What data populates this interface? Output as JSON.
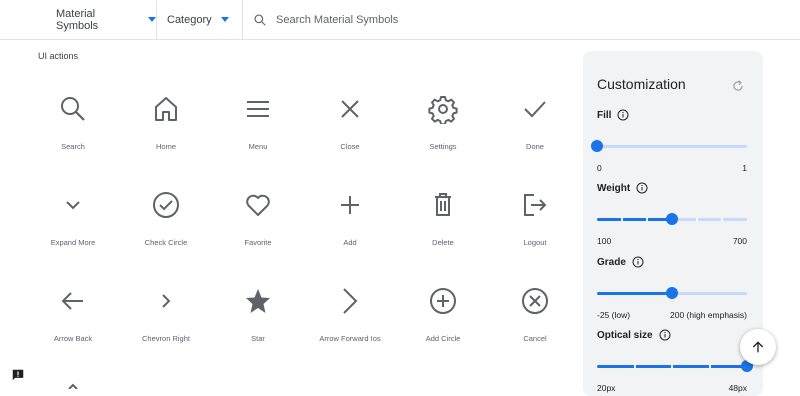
{
  "topbar": {
    "font_dropdown": "Material Symbols",
    "category_dropdown": "Category",
    "search_placeholder": "Search Material Symbols"
  },
  "section": {
    "title": "UI actions"
  },
  "icons": [
    {
      "label": "Search",
      "icon": "search-icon"
    },
    {
      "label": "Home",
      "icon": "home-icon"
    },
    {
      "label": "Menu",
      "icon": "menu-icon"
    },
    {
      "label": "Close",
      "icon": "close-icon"
    },
    {
      "label": "Settings",
      "icon": "settings-icon"
    },
    {
      "label": "Done",
      "icon": "done-icon"
    },
    {
      "label": "Expand More",
      "icon": "expand-more-icon"
    },
    {
      "label": "Check Circle",
      "icon": "check-circle-icon"
    },
    {
      "label": "Favorite",
      "icon": "favorite-icon"
    },
    {
      "label": "Add",
      "icon": "add-icon"
    },
    {
      "label": "Delete",
      "icon": "delete-icon"
    },
    {
      "label": "Logout",
      "icon": "logout-icon"
    },
    {
      "label": "Arrow Back",
      "icon": "arrow-back-icon"
    },
    {
      "label": "Chevron Right",
      "icon": "chevron-right-icon"
    },
    {
      "label": "Star",
      "icon": "star-icon"
    },
    {
      "label": "Arrow Forward Ios",
      "icon": "arrow-forward-ios-icon"
    },
    {
      "label": "Add Circle",
      "icon": "add-circle-icon"
    },
    {
      "label": "Cancel",
      "icon": "cancel-icon"
    }
  ],
  "customization": {
    "title": "Customization",
    "fill": {
      "label": "Fill",
      "min": "0",
      "max": "1",
      "value_fraction": 0
    },
    "weight": {
      "label": "Weight",
      "min": "100",
      "max": "700",
      "value_fraction": 0.5
    },
    "grade": {
      "label": "Grade",
      "min": "-25 (low)",
      "max": "200 (high emphasis)",
      "value_fraction": 0.5
    },
    "optical_size": {
      "label": "Optical size",
      "min": "20px",
      "max": "48px",
      "value_fraction": 1
    }
  },
  "colors": {
    "accent": "#1a73e8",
    "icon": "#5f6368",
    "panel": "#f1f3f4"
  }
}
